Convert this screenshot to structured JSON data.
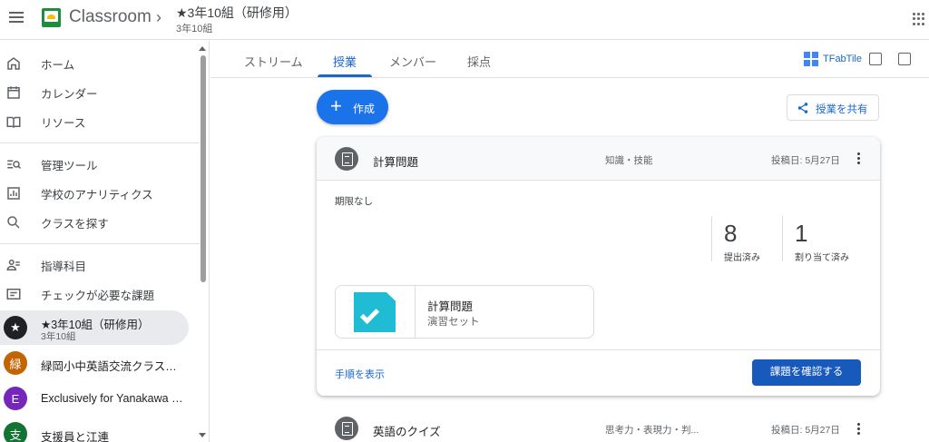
{
  "topbar": {
    "app_title": "Classroom",
    "class_name": "★3年10組（研修用）",
    "class_section": "3年10組"
  },
  "sidebar": {
    "nav": [
      {
        "label": "ホーム",
        "icon": "home-icon"
      },
      {
        "label": "カレンダー",
        "icon": "calendar-icon"
      },
      {
        "label": "リソース",
        "icon": "book-icon"
      },
      {
        "label": "管理ツール",
        "icon": "admin-tools-icon"
      },
      {
        "label": "学校のアナリティクス",
        "icon": "analytics-icon"
      },
      {
        "label": "クラスを探す",
        "icon": "search-icon"
      },
      {
        "label": "指導科目",
        "icon": "people-icon"
      },
      {
        "label": "チェックが必要な課題",
        "icon": "todo-icon"
      }
    ],
    "classes": [
      {
        "name": "★3年10組（研修用）",
        "section": "3年10組",
        "avatar": "★",
        "color": "#202124"
      },
      {
        "name": "緑岡小中英語交流クラスル...",
        "avatar": "緑",
        "color": "#c26401"
      },
      {
        "name": "Exclusively for Yanakawa a...",
        "avatar": "E",
        "color": "#7627bb"
      },
      {
        "name": "支援員と江連",
        "avatar": "支",
        "color": "#137333"
      }
    ]
  },
  "tabs": {
    "items": [
      "ストリーム",
      "授業",
      "メンバー",
      "採点"
    ],
    "active": "授業",
    "tfab_label": "TFabTile"
  },
  "main": {
    "create_label": "作成",
    "share_label": "授業を共有",
    "assignment": {
      "title": "計算問題",
      "topic": "知識・技能",
      "posted": "投稿日: 5月27日",
      "due": "期限なし",
      "turned_in": "8",
      "turned_in_label": "提出済み",
      "assigned": "1",
      "assigned_label": "割り当て済み",
      "attachment_title": "計算問題",
      "attachment_sub": "演習セット",
      "instructions_link": "手順を表示",
      "review_button": "課題を確認する"
    },
    "next_assignment": {
      "title": "英語のクイズ",
      "topic": "思考力・表現力・判...",
      "posted": "投稿日: 5月27日"
    }
  }
}
